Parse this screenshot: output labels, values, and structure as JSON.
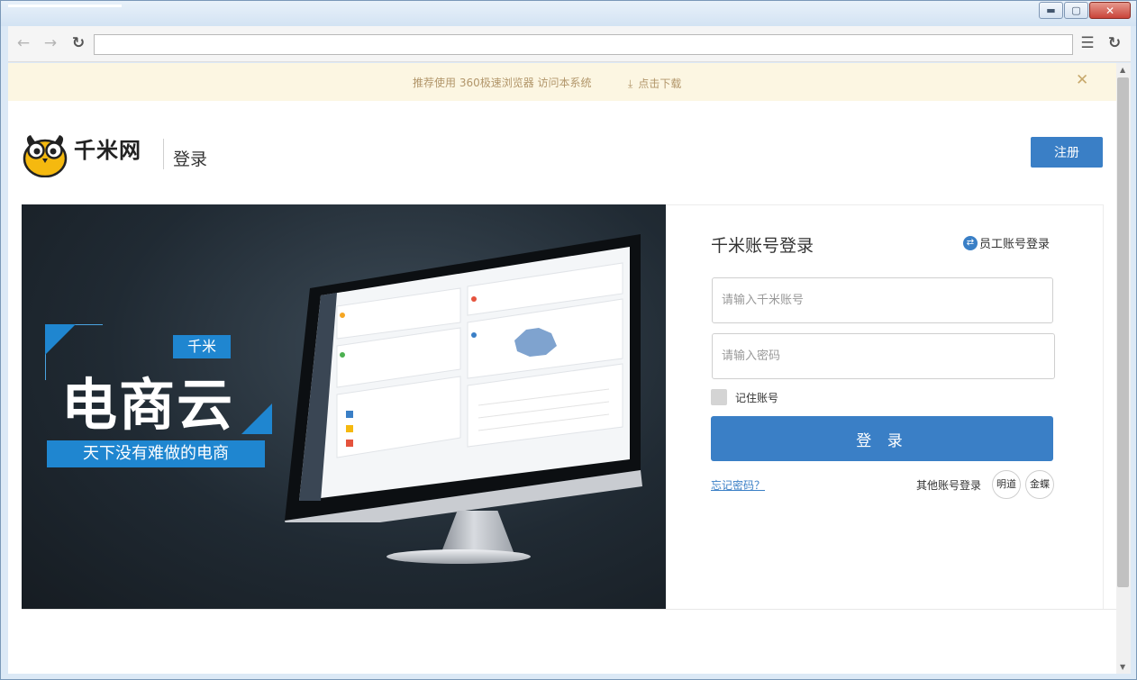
{
  "notice": {
    "text": "推荐使用 360极速浏览器 访问本系统",
    "download": "点击下载",
    "close": "✕"
  },
  "header": {
    "brand": "千米网",
    "title": "登录",
    "register": "注册"
  },
  "banner": {
    "tag": "千米",
    "headline": "电商云",
    "slogan": "天下没有难做的电商"
  },
  "login": {
    "title": "千米账号登录",
    "staff_login": "员工账号登录",
    "account_placeholder": "请输入千米账号",
    "password_placeholder": "请输入密码",
    "remember": "记住账号",
    "submit": "登 录",
    "forgot": "忘记密码？",
    "other_login": "其他账号登录",
    "other_options": [
      "明道",
      "金蝶"
    ]
  },
  "colors": {
    "primary": "#3a7fc6",
    "banner_accent": "#1f86d0",
    "notice_bg": "#fcf6e2",
    "notice_text": "#b2966a"
  },
  "icons": [
    "back-arrow-icon",
    "forward-arrow-icon",
    "reload-icon",
    "menu-icon",
    "download-icon",
    "close-icon",
    "swap-icon",
    "owl-logo"
  ]
}
